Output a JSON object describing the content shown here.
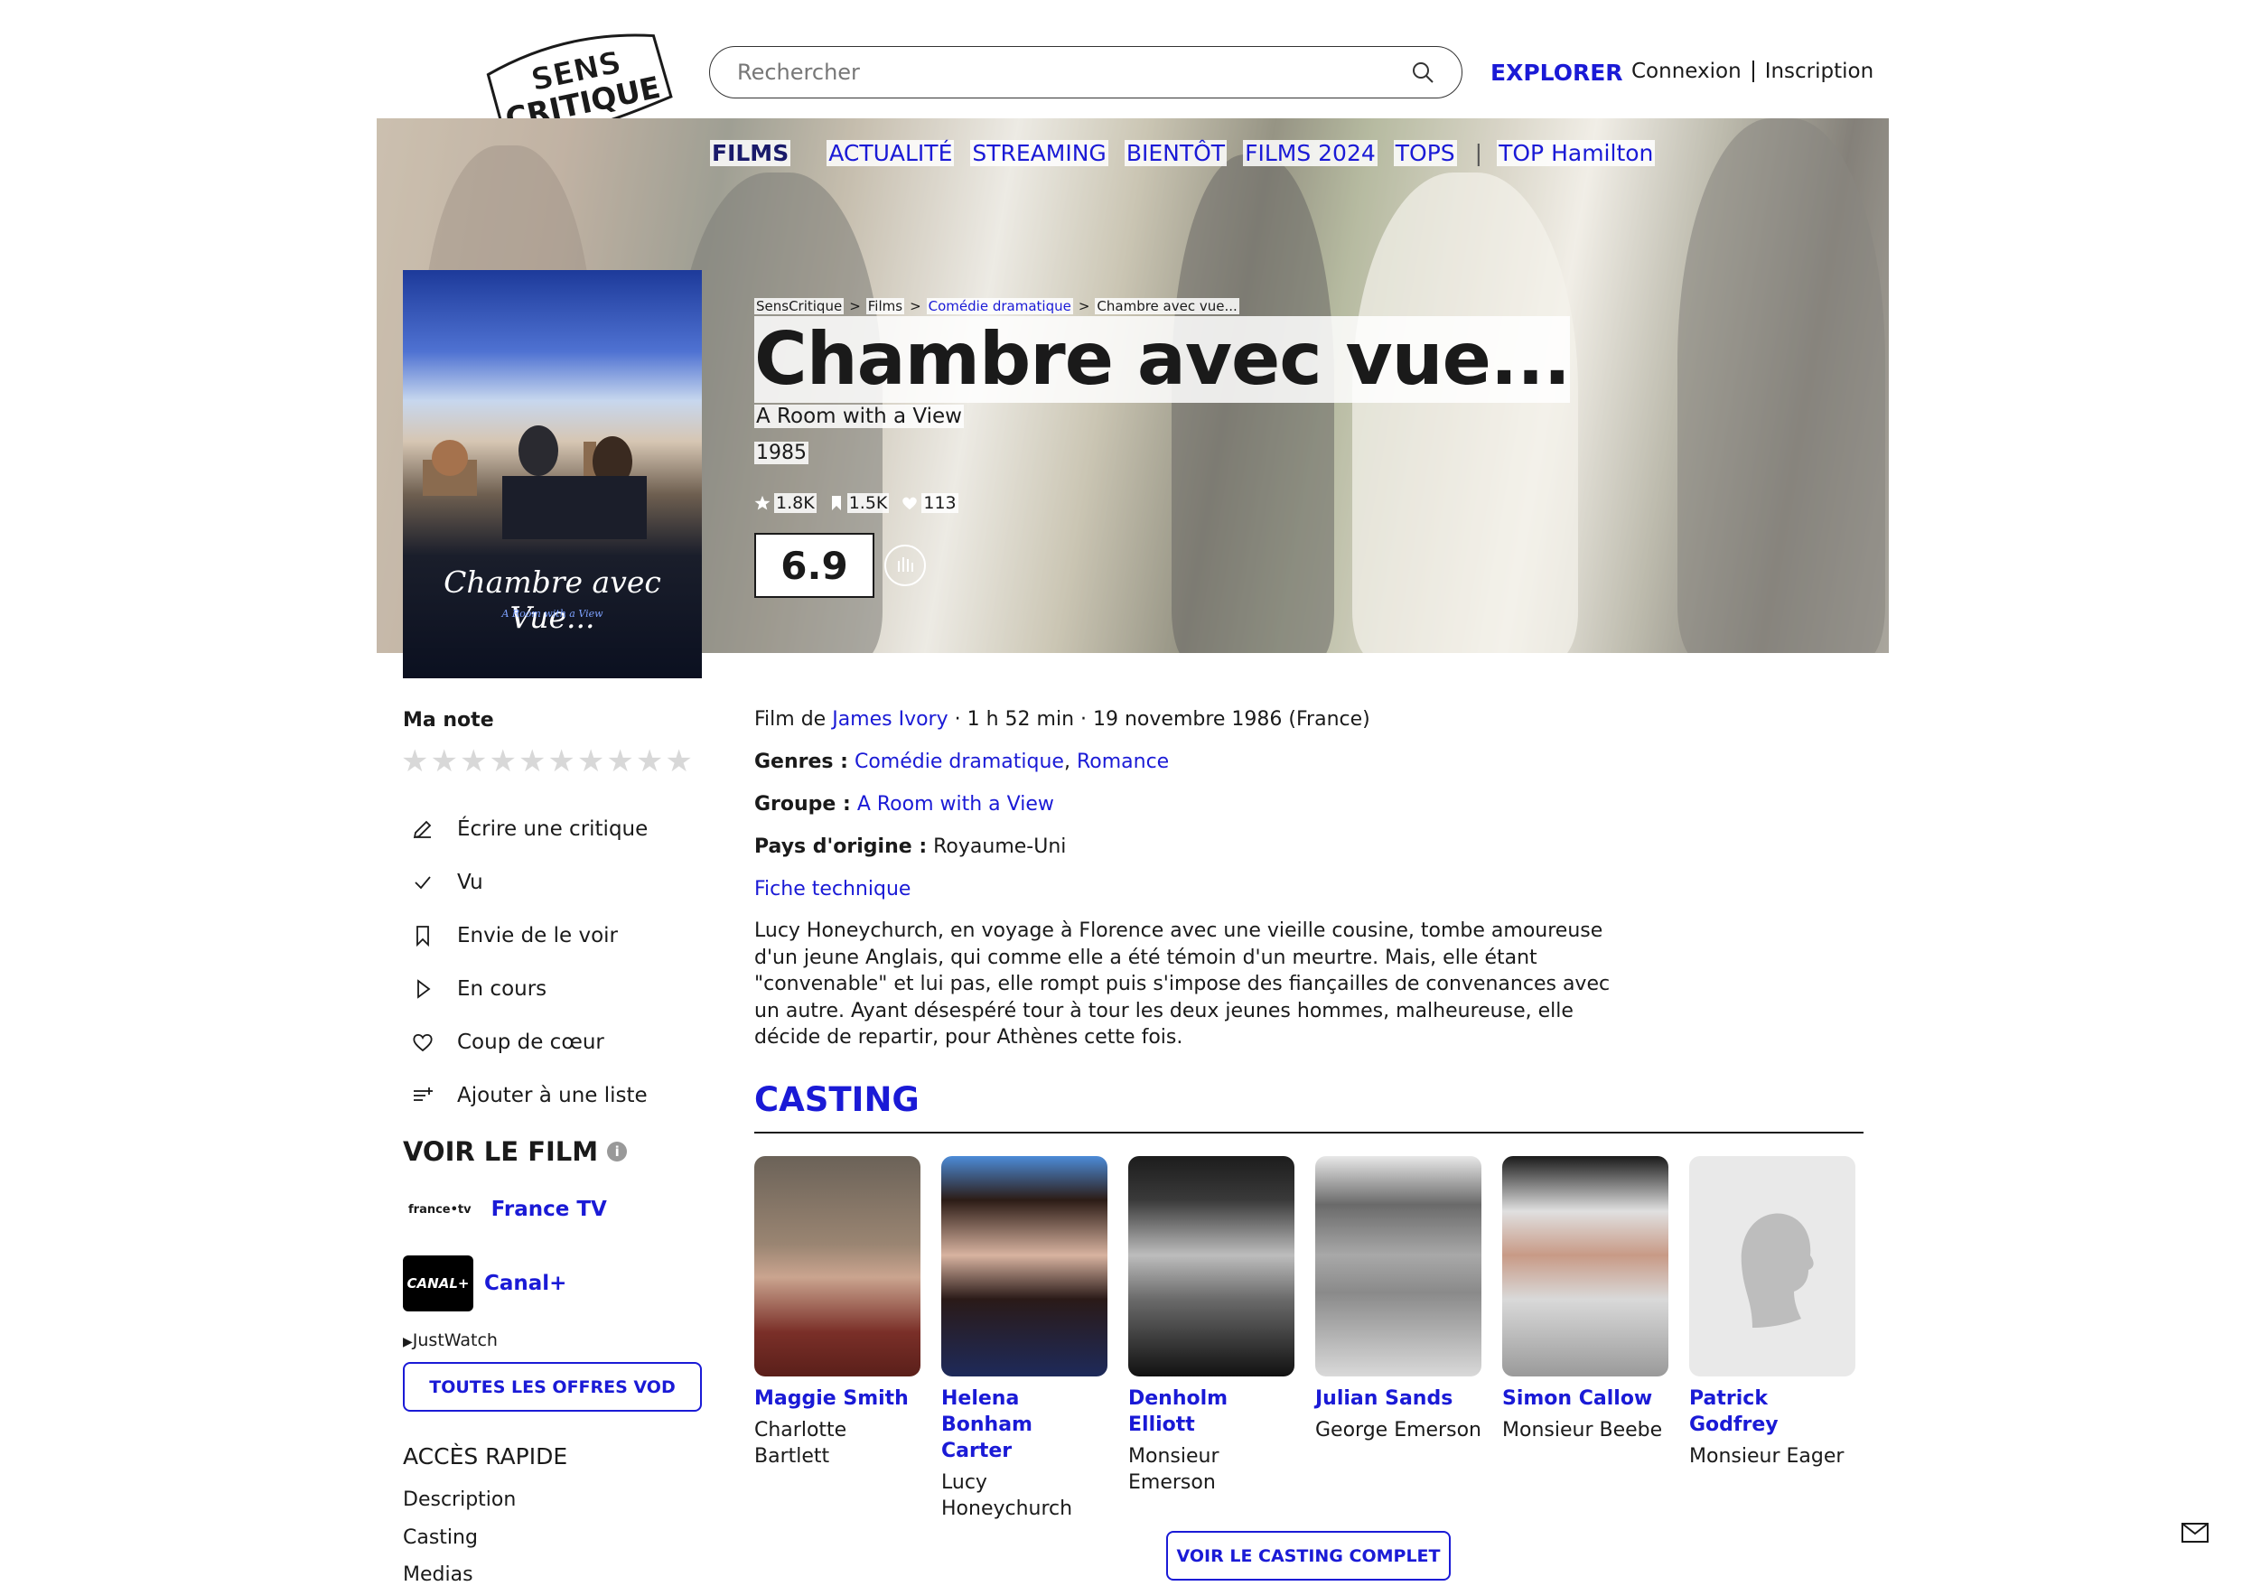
{
  "header": {
    "logo_line1": "SENS",
    "logo_line2": "CRITIQUE",
    "search_placeholder": "Rechercher",
    "explorer": "EXPLORER",
    "login": "Connexion",
    "signup": "Inscription"
  },
  "nav": {
    "items": [
      "FILMS",
      "ACTUALITÉ",
      "STREAMING",
      "BIENTÔT",
      "FILMS 2024",
      "TOPS"
    ],
    "separator": "|",
    "extra": "TOP Hamilton"
  },
  "breadcrumb": [
    "SensCritique",
    "Films",
    "Comédie dramatique",
    "Chambre avec vue..."
  ],
  "breadcrumb_sep": ">",
  "movie": {
    "title": "Chambre avec vue...",
    "original_title": "A Room with a View",
    "year": "1985",
    "stats": {
      "ratings": "1.8K",
      "wishlist": "1.5K",
      "favorites": "113"
    },
    "score": "6.9",
    "poster_title": "Chambre avec Vue...",
    "poster_subtitle": "A Room with a View"
  },
  "sidebar": {
    "my_rating_label": "Ma note",
    "star_count": 10,
    "actions": [
      {
        "icon": "pencil-icon",
        "label": "Écrire une critique"
      },
      {
        "icon": "check-icon",
        "label": "Vu"
      },
      {
        "icon": "bookmark-icon",
        "label": "Envie de le voir"
      },
      {
        "icon": "play-icon",
        "label": "En cours"
      },
      {
        "icon": "heart-icon",
        "label": "Coup de cœur"
      },
      {
        "icon": "add-list-icon",
        "label": "Ajouter à une liste"
      }
    ],
    "watch_title": "VOIR LE FILM",
    "providers": [
      {
        "logo_text": "france•tv",
        "name": "France TV"
      },
      {
        "logo_text": "CANAL+",
        "name": "Canal+"
      }
    ],
    "justwatch": "JustWatch",
    "vod_button": "TOUTES LES OFFRES VOD",
    "quick_access_title": "ACCÈS RAPIDE",
    "quick_links": [
      "Description",
      "Casting",
      "Medias"
    ]
  },
  "details": {
    "film_by_prefix": "Film de",
    "director": "James Ivory",
    "meta_suffix": " · 1 h 52 min · 19 novembre 1986 (France)",
    "genres_label": "Genres :",
    "genres": [
      "Comédie dramatique",
      "Romance"
    ],
    "group_label": "Groupe :",
    "group": "A Room with a View",
    "country_label": "Pays d'origine :",
    "country": "Royaume-Uni",
    "tech_sheet": "Fiche technique",
    "synopsis": "Lucy Honeychurch, en voyage à Florence avec une vieille cousine, tombe amoureuse d'un jeune Anglais, qui comme elle a été témoin d'un meurtre. Mais, elle étant \"convenable\" et lui pas, elle rompt puis s'impose des fiançailles de convenances avec un autre. Ayant désespéré tour à tour les deux jeunes hommes, malheureuse, elle décide de repartir, pour Athènes cette fois."
  },
  "casting": {
    "title": "CASTING",
    "members": [
      {
        "name": "Maggie Smith",
        "role": "Charlotte Bartlett"
      },
      {
        "name": "Helena Bonham Carter",
        "role": "Lucy Honeychurch"
      },
      {
        "name": "Denholm Elliott",
        "role": "Monsieur Emerson"
      },
      {
        "name": "Julian Sands",
        "role": "George Emerson"
      },
      {
        "name": "Simon Callow",
        "role": "Monsieur Beebe"
      },
      {
        "name": "Patrick Godfrey",
        "role": "Monsieur Eager"
      }
    ],
    "full_cast_button": "VOIR LE CASTING COMPLET"
  }
}
